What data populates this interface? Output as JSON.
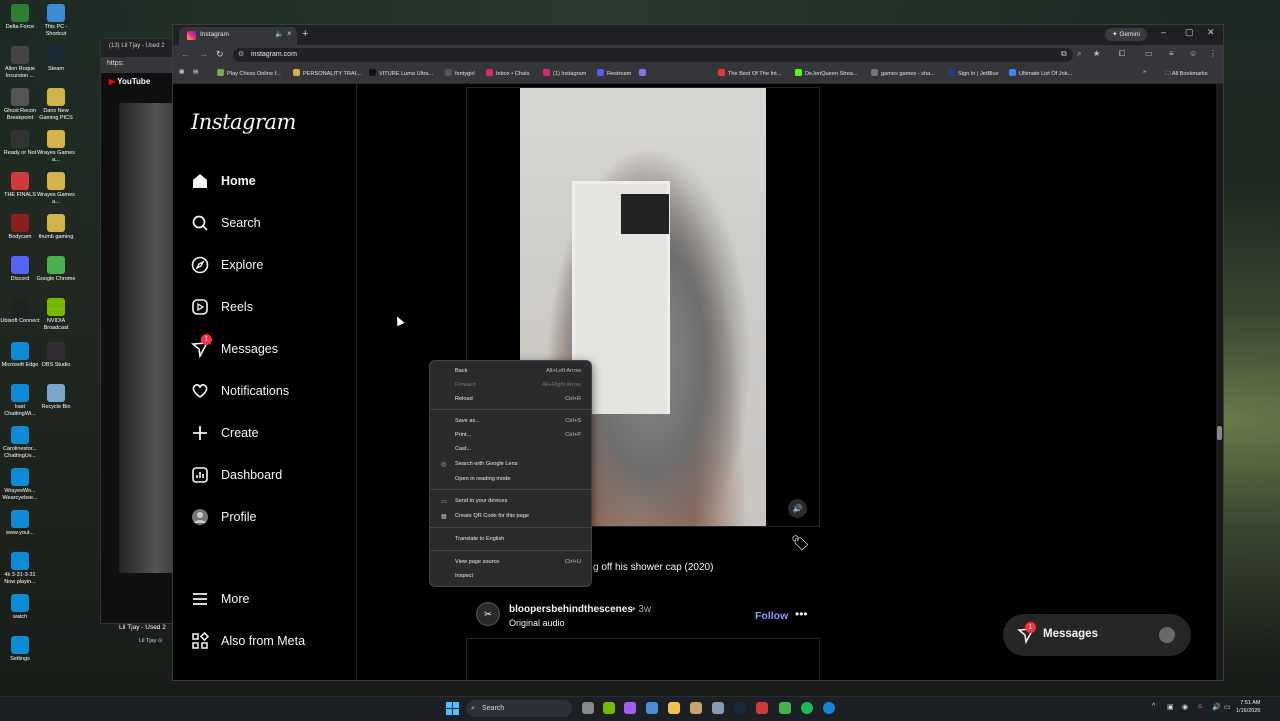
{
  "desktop": {
    "icons": [
      {
        "label": "Delta Force",
        "color": "#2e7d32"
      },
      {
        "label": "This PC - Shortcut",
        "color": "#3d8bd4"
      },
      {
        "label": "Allen Roque Incursion ...",
        "color": "#444"
      },
      {
        "label": "Steam",
        "color": "#1b2838"
      },
      {
        "label": "Ghost Recon Breakpoint",
        "color": "#555"
      },
      {
        "label": "Dans New Gaming PICS",
        "color": "#d4b24a"
      },
      {
        "label": "Ready or Not",
        "color": "#333"
      },
      {
        "label": "Wrayes Games a...",
        "color": "#d4b24a"
      },
      {
        "label": "THE FINALS",
        "color": "#d03a3a"
      },
      {
        "label": "Wrayes Games a...",
        "color": "#d4b24a"
      },
      {
        "label": "Bodycam",
        "color": "#8a1f1f"
      },
      {
        "label": "thumb gaming",
        "color": "#d4b24a"
      },
      {
        "label": "Discord",
        "color": "#5865f2"
      },
      {
        "label": "Google Chrome",
        "color": "#4caf50"
      },
      {
        "label": "Ubisoft Connect",
        "color": "#222"
      },
      {
        "label": "NVIDIA Broadcast",
        "color": "#76b900"
      },
      {
        "label": "Microsoft Edge",
        "color": "#0f8ad6"
      },
      {
        "label": "OBS Studio",
        "color": "#302e31"
      },
      {
        "label": "kast ChattingWi...",
        "color": "#0f8ad6"
      },
      {
        "label": "Recycle Bin",
        "color": "#7aa7c7"
      },
      {
        "label": "Carolinestor... ChattingUv...",
        "color": "#0f8ad6"
      },
      {
        "label": "WrayesWo... Wearcyebse...",
        "color": "#0f8ad6"
      },
      {
        "label": "www.yout...",
        "color": "#0f8ad6"
      },
      {
        "label": "4k 3-31-3-31 Now playin...",
        "color": "#0f8ad6"
      },
      {
        "label": "watch",
        "color": "#0f8ad6"
      },
      {
        "label": "Settings",
        "color": "#0f8ad6"
      }
    ]
  },
  "youtube_window": {
    "tab_title": "(13) Lil Tjay - Used 2",
    "address": "https:",
    "header": "YouTube",
    "video_title": "Lil Tjay - Used 2",
    "channel": "Lil Tjay ⊙"
  },
  "browser": {
    "tab_title": "Instagram",
    "new_tab": "+",
    "gemini": "✦ Gemini",
    "url": "instagram.com",
    "bookmarks": [
      {
        "label": "Play Chess Online f...",
        "color": "#7fa650"
      },
      {
        "label": "PERSONALITY TRAI...",
        "color": "#d4b24a"
      },
      {
        "label": "VITURE Luma Ultra...",
        "color": "#111"
      },
      {
        "label": "fentygirl",
        "color": "#555"
      },
      {
        "label": "Inbox • Chats",
        "color": "#d62976"
      },
      {
        "label": "(1) Instagram",
        "color": "#d62976"
      },
      {
        "label": "Restream",
        "color": "#5b5bf0"
      },
      {
        "label": "",
        "color": "#8a6fe0"
      },
      {
        "label": "The Best Of The Int...",
        "color": "#e53935"
      },
      {
        "label": "DeJenQueen Strea...",
        "color": "#53fc18"
      },
      {
        "label": "games games - sha...",
        "color": "#777"
      },
      {
        "label": "Sign In | JetBlue",
        "color": "#1e3a8a"
      },
      {
        "label": "Ultimate List Of Jok...",
        "color": "#4285f4"
      }
    ],
    "all_bookmarks": "All Bookmarks"
  },
  "instagram": {
    "logo": "Instagram",
    "nav": [
      {
        "name": "home",
        "label": "Home",
        "icon": "home-icon",
        "bold": true
      },
      {
        "name": "search",
        "label": "Search",
        "icon": "search-icon"
      },
      {
        "name": "explore",
        "label": "Explore",
        "icon": "compass-icon"
      },
      {
        "name": "reels",
        "label": "Reels",
        "icon": "reels-icon"
      },
      {
        "name": "messages",
        "label": "Messages",
        "icon": "messenger-icon",
        "badge": "1"
      },
      {
        "name": "notifications",
        "label": "Notifications",
        "icon": "heart-icon"
      },
      {
        "name": "create",
        "label": "Create",
        "icon": "plus-icon"
      },
      {
        "name": "dashboard",
        "label": "Dashboard",
        "icon": "dashboard-icon"
      },
      {
        "name": "profile",
        "label": "Profile",
        "icon": "avatar-icon"
      }
    ],
    "more": "More",
    "also_from_meta": "Also from Meta",
    "post": {
      "caption": "g off his shower cap (2020)",
      "author": "bloopersbehindthescenes",
      "age": "• 3w",
      "audio": "Original audio",
      "follow": "Follow"
    },
    "messages_widget": {
      "label": "Messages",
      "badge": "1"
    }
  },
  "context_menu": [
    {
      "label": "Back",
      "shortcut": "Alt+Left Arrow",
      "disabled": false
    },
    {
      "label": "Forward",
      "shortcut": "Alt+Right Arrow",
      "disabled": true
    },
    {
      "label": "Reload",
      "shortcut": "Ctrl+R",
      "disabled": false
    },
    {
      "label": "Save as...",
      "shortcut": "Ctrl+S",
      "disabled": false
    },
    {
      "label": "Print...",
      "shortcut": "Ctrl+P",
      "disabled": false
    },
    {
      "label": "Cast...",
      "shortcut": "",
      "disabled": false
    },
    {
      "label": "Search with Google Lens",
      "shortcut": "",
      "disabled": false,
      "icon": "lens-icon"
    },
    {
      "label": "Open in reading mode",
      "shortcut": "",
      "disabled": false
    },
    {
      "label": "Send to your devices",
      "shortcut": "",
      "disabled": false,
      "icon": "devices-icon"
    },
    {
      "label": "Create QR Code for this page",
      "shortcut": "",
      "disabled": false,
      "icon": "qr-icon"
    },
    {
      "label": "Translate to English",
      "shortcut": "",
      "disabled": false
    },
    {
      "label": "View page source",
      "shortcut": "Ctrl+U",
      "disabled": false
    },
    {
      "label": "Inspect",
      "shortcut": "",
      "disabled": false
    }
  ],
  "taskbar": {
    "search_placeholder": "Search",
    "time": "7:51 AM",
    "date": "1/16/2026"
  }
}
